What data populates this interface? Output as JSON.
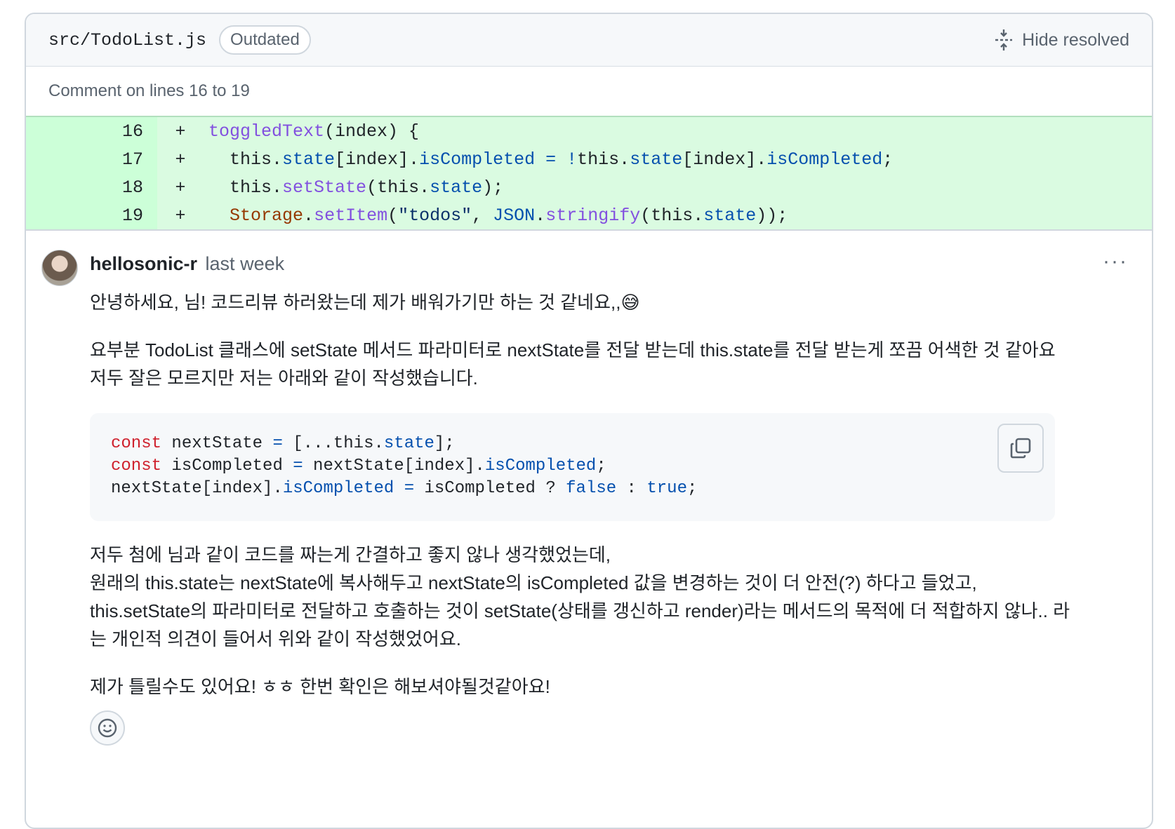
{
  "file": {
    "path": "src/TodoList.js",
    "badge": "Outdated",
    "hide_resolved": "Hide resolved"
  },
  "comment_on": "Comment on lines 16 to 19",
  "diff": {
    "lines": [
      {
        "num": "16",
        "sign": "+"
      },
      {
        "num": "17",
        "sign": "+"
      },
      {
        "num": "18",
        "sign": "+"
      },
      {
        "num": "19",
        "sign": "+"
      }
    ],
    "code_text": [
      "toggledText(index) {",
      "  this.state[index].isCompleted = !this.state[index].isCompleted;",
      "  this.setState(this.state);",
      "  Storage.setItem(\"todos\", JSON.stringify(this.state));"
    ]
  },
  "comment": {
    "author": "hellosonic-r",
    "time": "last week",
    "more": "···",
    "p1": "안녕하세요,  님! 코드리뷰 하러왔는데 제가 배워가기만 하는 것 같네요,,😅",
    "p2_line1": "요부분 TodoList 클래스에 setState 메서드 파라미터로 nextState를 전달 받는데 this.state를 전달 받는게 쪼끔 어색한 것 같아요",
    "p2_line2": "저두 잘은 모르지만 저는 아래와 같이 작성했습니다.",
    "code_text": [
      "const nextState = [...this.state];",
      "const isCompleted = nextState[index].isCompleted;",
      "nextState[index].isCompleted = isCompleted ? false : true;"
    ],
    "p3_line1": "저두 첨에  님과 같이 코드를 짜는게 간결하고 좋지 않나 생각했었는데,",
    "p3_line2": "원래의 this.state는 nextState에 복사해두고 nextState의 isCompleted 값을 변경하는 것이 더 안전(?) 하다고 들었고,",
    "p3_line3": "this.setState의 파라미터로 전달하고 호출하는 것이 setState(상태를 갱신하고 render)라는 메서드의 목적에 더 적합하지 않나.. 라",
    "p3_line4": "는 개인적 의견이 들어서 위와 같이 작성했었어요.",
    "p4": "제가 틀릴수도 있어요! ㅎㅎ 한번 확인은 해보셔야될것같아요!"
  },
  "icons": {
    "hide_resolved": "fold-icon",
    "copy": "copy-icon",
    "reaction": "smiley-icon"
  },
  "colors": {
    "diff_bg": "#dafbe1",
    "line_number_bg": "#ccffd8",
    "keyword_red": "#cf222e",
    "keyword_blue": "#0550ae",
    "func_purple": "#8250df"
  }
}
